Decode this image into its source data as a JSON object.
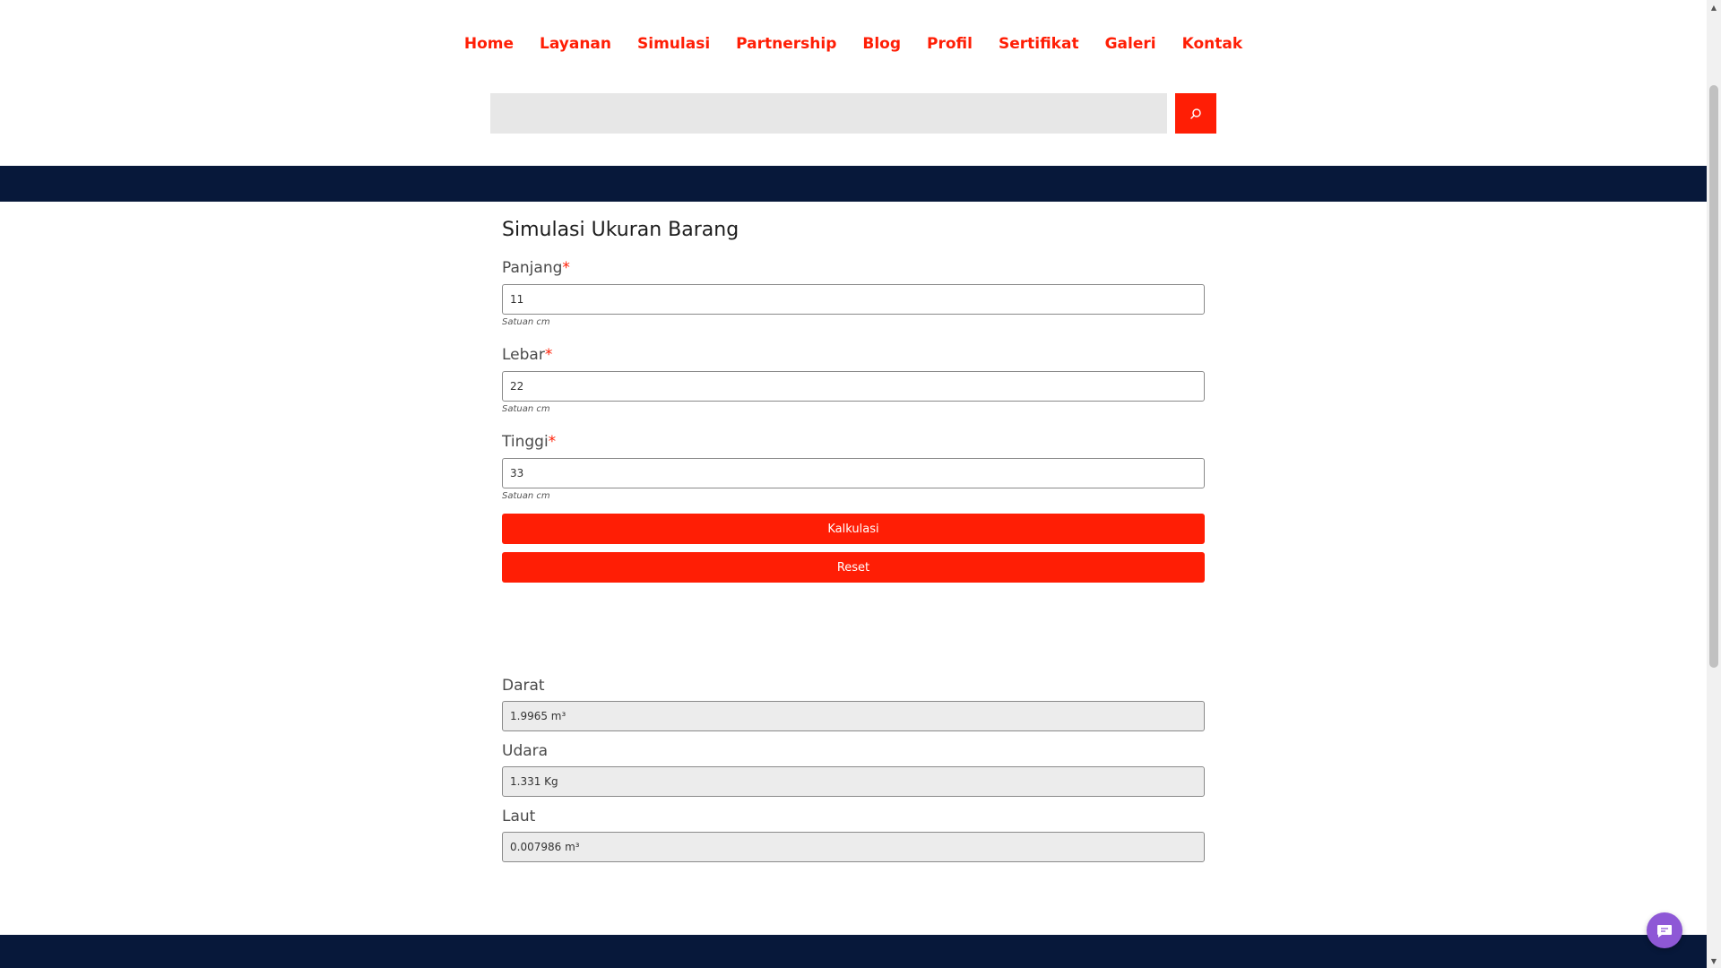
{
  "nav": {
    "items": [
      "Home",
      "Layanan",
      "Simulasi",
      "Partnership",
      "Blog",
      "Profil",
      "Sertifikat",
      "Galeri",
      "Kontak"
    ]
  },
  "search": {
    "placeholder": "",
    "value": "",
    "icon": "search-icon"
  },
  "form": {
    "title": "Simulasi Ukuran Barang",
    "required_marker": "*",
    "fields": [
      {
        "label": "Panjang",
        "value": "11",
        "help": "Satuan cm"
      },
      {
        "label": "Lebar",
        "value": "22",
        "help": "Satuan cm"
      },
      {
        "label": "Tinggi",
        "value": "33",
        "help": "Satuan cm"
      }
    ],
    "calculate_label": "Kalkulasi",
    "reset_label": "Reset"
  },
  "results": [
    {
      "label": "Darat",
      "value": "1.9965 m³"
    },
    {
      "label": "Udara",
      "value": "1.331 Kg"
    },
    {
      "label": "Laut",
      "value": "0.007986 m³"
    }
  ],
  "colors": {
    "accent": "#ff1e05",
    "navy": "#07183a",
    "chat": "#8e58d6"
  },
  "chat": {
    "icon": "chat-icon"
  }
}
